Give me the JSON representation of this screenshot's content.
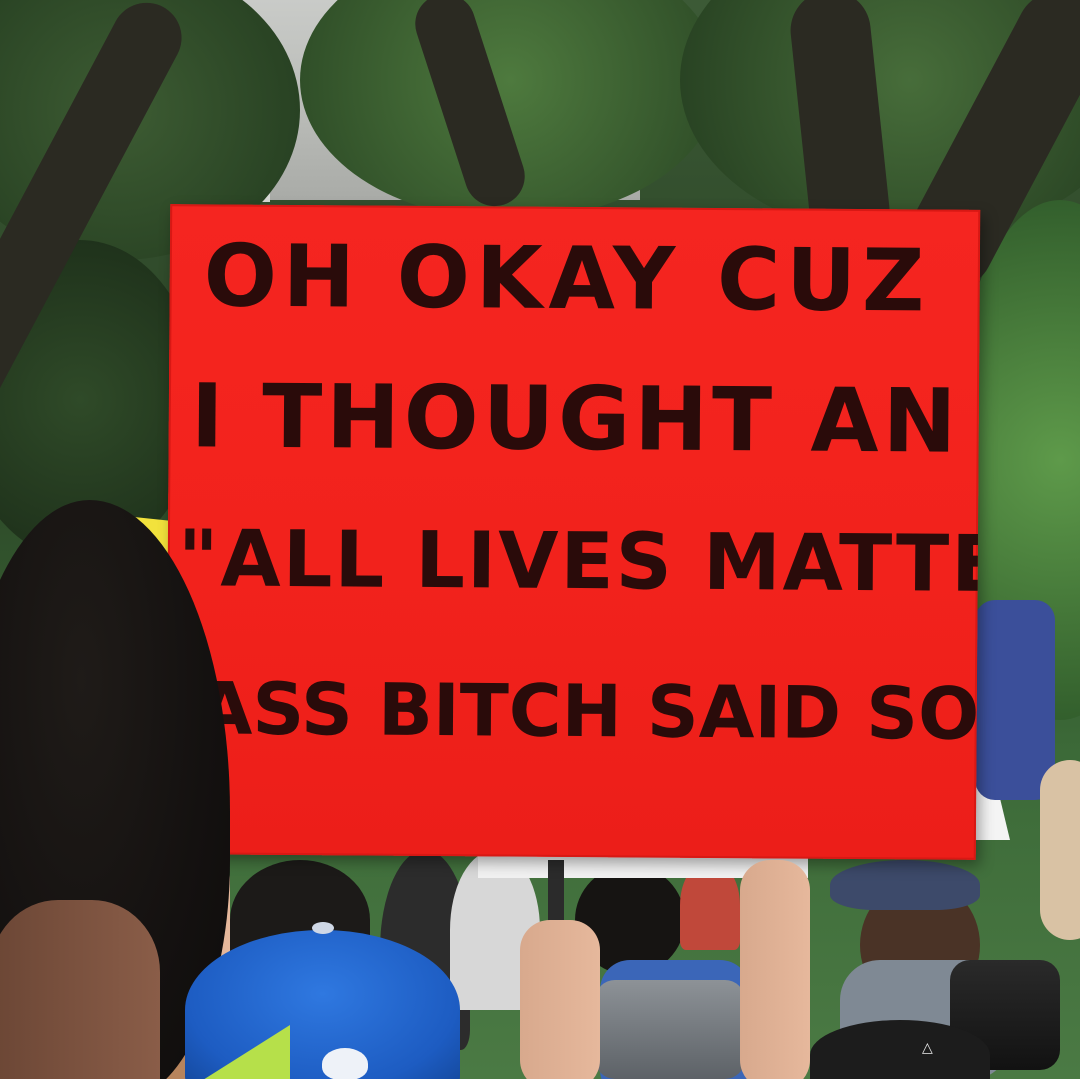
{
  "photo": {
    "sign": {
      "color": "#f2221c",
      "ink_color": "#2a0b0a",
      "lines": [
        "OH  OKAY CUZ",
        "I THOUGHT AN",
        "\"ALL LIVES MATTER\"",
        "ASS BITCH SAID SOMETHIN'"
      ]
    },
    "scene_elements": {
      "background": "trees-and-building",
      "foreground": "protest-crowd"
    }
  }
}
